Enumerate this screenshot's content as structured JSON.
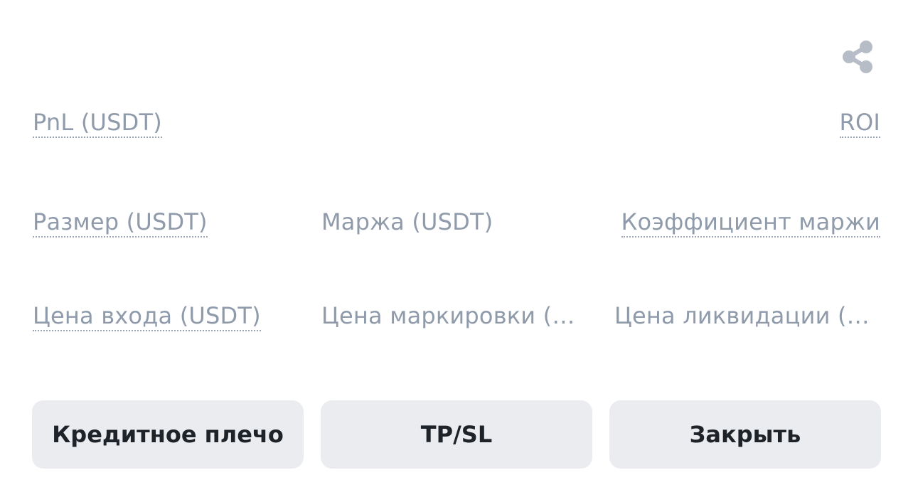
{
  "header": {
    "share_icon": "share-icon"
  },
  "position": {
    "pnl_label": "PnL (USDT)",
    "roi_label": "ROI",
    "size_label": "Размер (USDT)",
    "margin_label": "Маржа (USDT)",
    "margin_ratio_label": "Коэффициент маржи",
    "entry_price_label": "Цена входа (USDT)",
    "mark_price_label": "Цена маркировки (USDT)",
    "liq_price_label": "Цена ликвидации (USDT)"
  },
  "actions": {
    "leverage_label": "Кредитное плечо",
    "tpsl_label": "TP/SL",
    "close_label": "Закрыть"
  },
  "colors": {
    "label_gray": "#8f9bab",
    "button_bg": "#eaecef",
    "button_text": "#1e2329",
    "icon_gray": "#b7bdc6"
  }
}
